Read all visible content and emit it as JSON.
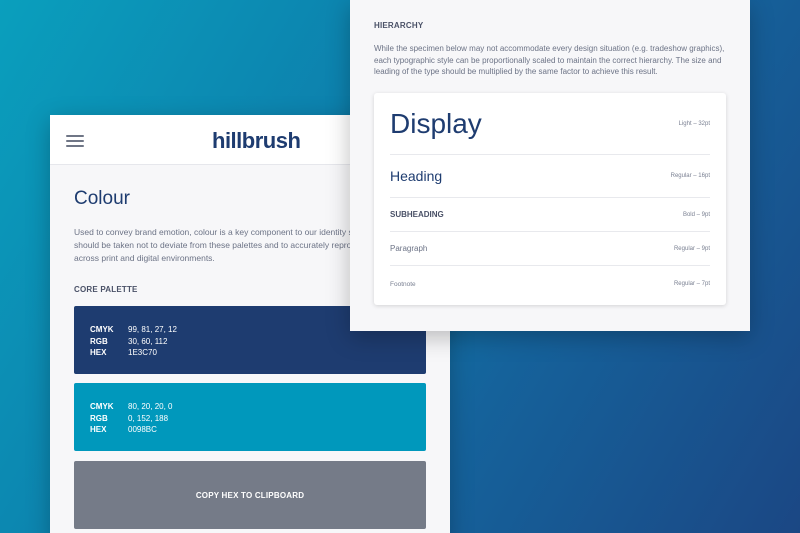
{
  "colour_page": {
    "brand": "hillbrush",
    "title": "Colour",
    "intro": "Used to convey brand emotion, colour is a key component to our identity system. Care should be taken not to deviate from these palettes and to accurately reproduce each colour across print and digital environments.",
    "section_label": "CORE PALETTE",
    "swatches": [
      {
        "color": "#1E3C70",
        "cmyk_label": "CMYK",
        "cmyk": "99, 81, 27, 12",
        "rgb_label": "RGB",
        "rgb": "30, 60, 112",
        "hex_label": "HEX",
        "hex": "1E3C70"
      },
      {
        "color": "#0098BC",
        "cmyk_label": "CMYK",
        "cmyk": "80, 20, 20, 0",
        "rgb_label": "RGB",
        "rgb": "0, 152, 188",
        "hex_label": "HEX",
        "hex": "0098BC"
      }
    ],
    "copy_button": "COPY HEX TO CLIPBOARD",
    "copy_button_color": "#757B88"
  },
  "hierarchy_page": {
    "label": "HIERARCHY",
    "description": "While the specimen below may not accommodate every design situation (e.g. tradeshow graphics), each typographic style can be proportionally scaled to maintain the correct hierarchy. The size and leading of the type should be multiplied by the same factor to achieve this result.",
    "specimens": [
      {
        "sample": "Display",
        "meta": "Light – 32pt"
      },
      {
        "sample": "Heading",
        "meta": "Regular – 16pt"
      },
      {
        "sample": "SUBHEADING",
        "meta": "Bold – 9pt"
      },
      {
        "sample": "Paragraph",
        "meta": "Regular – 9pt"
      },
      {
        "sample": "Footnote",
        "meta": "Regular – 7pt"
      }
    ]
  },
  "icons": {
    "menu": "hamburger-menu-icon"
  },
  "colors": {
    "brand_navy": "#1E3C70",
    "brand_cyan": "#0098BC"
  }
}
